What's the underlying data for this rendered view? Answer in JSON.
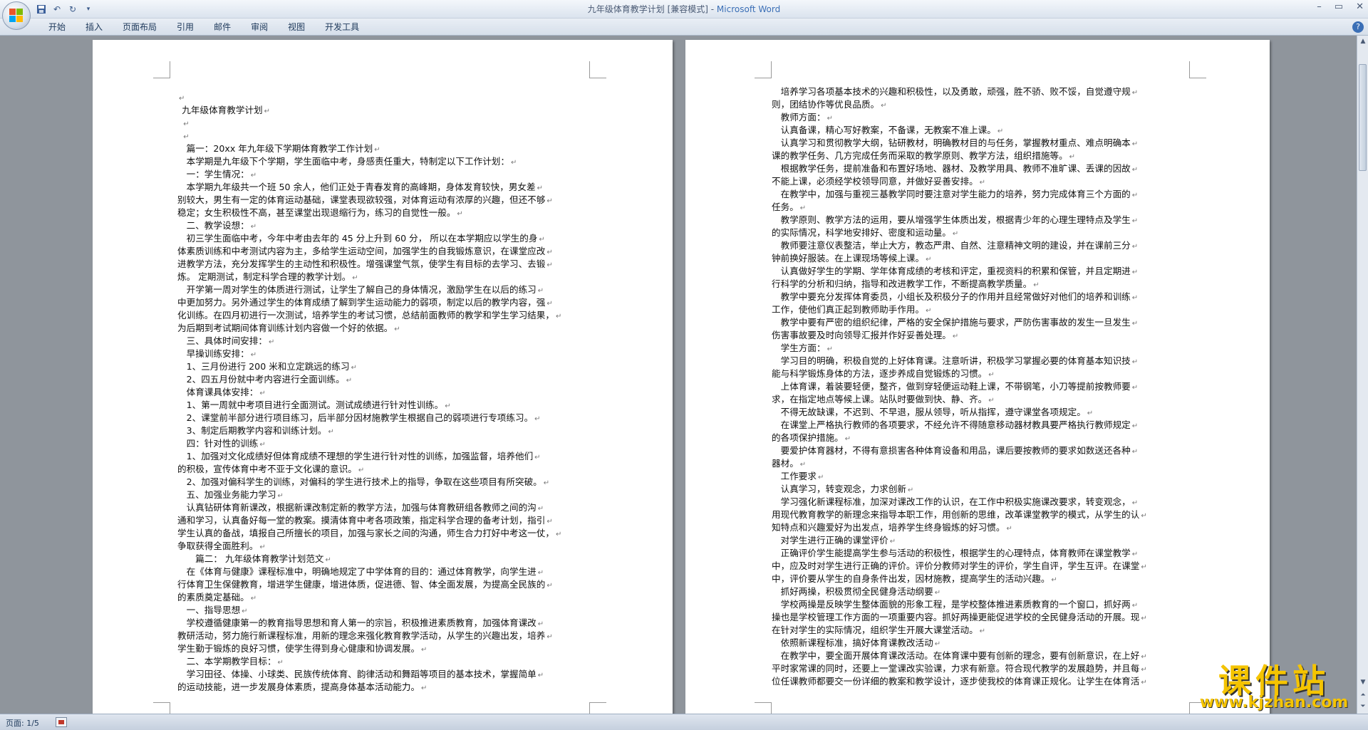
{
  "window": {
    "title": "九年级体育教学计划 [兼容模式] - ",
    "brand": "Microsoft Word"
  },
  "quick_access": {
    "icons": [
      "save-icon",
      "undo-icon",
      "redo-icon",
      "customize-icon"
    ]
  },
  "ribbon": {
    "tabs": [
      "开始",
      "插入",
      "页面布局",
      "引用",
      "邮件",
      "审阅",
      "视图",
      "开发工具"
    ]
  },
  "status": {
    "page": "页面: 1/5"
  },
  "watermark": {
    "title": "课件站",
    "url": "www.kjzhan.com"
  },
  "pages": [
    {
      "lines": [
        {
          "t": "",
          "i": 0
        },
        {
          "t": "九年级体育教学计划",
          "i": 1
        },
        {
          "t": "",
          "i": 1
        },
        {
          "t": "",
          "i": 1
        },
        {
          "t": "篇一：20xx 年九年级下学期体育教学工作计划",
          "i": 2
        },
        {
          "t": "本学期是九年级下个学期，学生面临中考，身感责任重大，特制定以下工作计划：",
          "i": 2
        },
        {
          "t": "一：学生情况：",
          "i": 2
        },
        {
          "t": "本学期九年级共一个班 50 余人，他们正处于青春发育的高峰期，身体发育较快，男女差",
          "i": 2
        },
        {
          "t": "别较大，男生有一定的体育运动基础，课堂表现欲较强，对体育运动有浓厚的兴趣，但还不够",
          "i": 0
        },
        {
          "t": "稳定；女生积极性不高，甚至课堂出现退缩行为，练习的自觉性一般。",
          "i": 0
        },
        {
          "t": "二、教学设想：",
          "i": 2
        },
        {
          "t": "初三学生面临中考，今年中考由去年的 45 分上升到 60 分，  所以在本学期应以学生的身",
          "i": 2
        },
        {
          "t": "体素质训练和中考测试内容为主，多给学生运动空间，加强学生的自我锻炼意识，在课堂应改",
          "i": 0
        },
        {
          "t": "进教学方法，充分发挥学生的主动性和积极性。增强课堂气氛，使学生有目标的去学习、去锻",
          "i": 0
        },
        {
          "t": "炼。          定期测试，制定科学合理的教学计划。",
          "i": 0
        },
        {
          "t": "开学第一周对学生的体质进行测试，让学生了解自己的身体情况，激励学生在以后的练习",
          "i": 2
        },
        {
          "t": "中更加努力。另外通过学生的体育成绩了解到学生运动能力的弱项，制定以后的教学内容，强",
          "i": 0
        },
        {
          "t": "化训练。在四月初进行一次测试，培养学生的考试习惯，总结前面教师的教学和学生学习结果，",
          "i": 0
        },
        {
          "t": "为后期到考试期间体育训练计划内容做一个好的依据。",
          "i": 0
        },
        {
          "t": "三、具体时间安排：",
          "i": 2
        },
        {
          "t": "早操训练安排：",
          "i": 2
        },
        {
          "t": "1、三月份进行 200 米和立定跳远的练习",
          "i": 2
        },
        {
          "t": "2、四五月份就中考内容进行全面训练。",
          "i": 2
        },
        {
          "t": "体育课具体安排：",
          "i": 2
        },
        {
          "t": "1、第一周就中考项目进行全面测试。测试成绩进行针对性训练。",
          "i": 2
        },
        {
          "t": "2、课堂前半部分进行项目练习，后半部分因材施教学生根据自己的弱项进行专项练习。",
          "i": 2
        },
        {
          "t": "3、制定后期教学内容和训练计划。",
          "i": 2
        },
        {
          "t": "四：针对性的训练",
          "i": 2
        },
        {
          "t": "1、加强对文化成绩好但体育成绩不理想的学生进行针对性的训练，加强监督，培养他们",
          "i": 2
        },
        {
          "t": "的积极，宣传体育中考不亚于文化课的意识。",
          "i": 0
        },
        {
          "t": "2、加强对偏科学生的训练，对偏科的学生进行技术上的指导，争取在这些项目有所突破。",
          "i": 2
        },
        {
          "t": "五、加强业务能力学习",
          "i": 2
        },
        {
          "t": "认真钻研体育新课改，根据新课改制定新的教学方法，加强与体育教研组各教师之间的沟",
          "i": 2
        },
        {
          "t": "通和学习，认真备好每一堂的教案。摸清体育中考各项政策，指定科学合理的备考计划，指引",
          "i": 0
        },
        {
          "t": "学生认真的备战，填报自己所擅长的项目，加强与家长之间的沟通，师生合力打好中考这一仗，",
          "i": 0
        },
        {
          "t": "争取获得全面胜利。",
          "i": 0
        },
        {
          "t": "篇二：  九年级体育教学计划范文",
          "i": 4
        },
        {
          "t": "在《体育与健康》课程标准中，明确地规定了中学体育的目的：通过体育教学，向学生进",
          "i": 2
        },
        {
          "t": "行体育卫生保健教育，增进学生健康，增进体质，促进德、智、体全面发展，为提高全民族的",
          "i": 0
        },
        {
          "t": "的素质奠定基础。",
          "i": 0
        },
        {
          "t": "一、指导思想",
          "i": 2
        },
        {
          "t": "学校遵循健康第一的教育指导思想和育人第一的宗旨，积极推进素质教育，加强体育课改",
          "i": 2
        },
        {
          "t": "教研活动，努力施行新课程标准，用新的理念来强化教育教学活动，从学生的兴趣出发，培养",
          "i": 0
        },
        {
          "t": "学生勤于锻炼的良好习惯，使学生得到身心健康和协调发展。",
          "i": 0
        },
        {
          "t": "二、本学期教学目标：",
          "i": 2
        },
        {
          "t": "学习田径、体操、小球类、民族传统体育、韵律活动和舞蹈等项目的基本技术，掌握简单",
          "i": 2
        },
        {
          "t": "的运动技能，进一步发展身体素质，提高身体基本活动能力。",
          "i": 0
        }
      ]
    },
    {
      "lines": [
        {
          "t": "培养学习各项基本技术的兴趣和积极性，以及勇敢，顽强，胜不骄、败不馁，自觉遵守规",
          "i": 2
        },
        {
          "t": "则，团结协作等优良品质。",
          "i": 0
        },
        {
          "t": "教师方面：",
          "i": 2
        },
        {
          "t": "认真备课，精心写好教案，不备课，无教案不准上课。",
          "i": 2
        },
        {
          "t": "认真学习和贯彻教学大纲，钻研教材，明确教材目的与任务，掌握教材重点、难点明确本",
          "i": 2
        },
        {
          "t": "课的教学任务、几方完成任务而采取的教学原则、教学方法，组织措施等。",
          "i": 0
        },
        {
          "t": "根据教学任务，提前准备和布置好场地、器材、及教学用具、教师不准旷课、丢课的因故",
          "i": 2
        },
        {
          "t": "不能上课，必须经学校领导同意，并做好妥善安排。",
          "i": 0
        },
        {
          "t": "在教学中，加强与重视三基教学同时要注意对学生能力的培养，努力完成体育三个方面的",
          "i": 2
        },
        {
          "t": "任务。",
          "i": 0
        },
        {
          "t": "教学原则、教学方法的运用，要从增强学生体质出发，根据青少年的心理生理特点及学生",
          "i": 2
        },
        {
          "t": "的实际情况，科学地安排好、密度和运动量。",
          "i": 0
        },
        {
          "t": "教师要注意仪表整洁，举止大方，教态严肃、自然、注意精神文明的建设，并在课前三分",
          "i": 2
        },
        {
          "t": "钟前换好服装。在上课现场等候上课。",
          "i": 0
        },
        {
          "t": "认真做好学生的学期、学年体育成绩的考核和评定，重视资料的积累和保管，并且定期进",
          "i": 2
        },
        {
          "t": "行科学的分析和归纳，指导和改进教学工作，不断提高教学质量。",
          "i": 0
        },
        {
          "t": "教学中要充分发挥体育委员，小组长及积极分子的作用并且经常做好对他们的培养和训练",
          "i": 2
        },
        {
          "t": "工作，使他们真正起到教师助手作用。",
          "i": 0
        },
        {
          "t": "教学中要有严密的组织纪律，严格的安全保护措施与要求，严防伤害事故的发生一旦发生",
          "i": 2
        },
        {
          "t": "伤害事故要及时向领导汇报并作好妥善处理。",
          "i": 0
        },
        {
          "t": "学生方面：",
          "i": 2
        },
        {
          "t": "学习目的明确，积极自觉的上好体育课。注意听讲，积极学习掌握必要的体育基本知识技",
          "i": 2
        },
        {
          "t": "能与科学锻炼身体的方法，逐步养成自觉锻炼的习惯。",
          "i": 0
        },
        {
          "t": "上体育课，着装要轻便，整齐，做到穿轻便运动鞋上课，不带钢笔，小刀等提前按教师要",
          "i": 2
        },
        {
          "t": "求，在指定地点等候上课。站队时要做到快、静、齐。",
          "i": 0
        },
        {
          "t": "不得无故缺课，不迟到、不早退，服从领导，听从指挥，遵守课堂各项规定。",
          "i": 2
        },
        {
          "t": "在课堂上严格执行教师的各项要求，不经允许不得随意移动器材教具要严格执行教师规定",
          "i": 2
        },
        {
          "t": "的各项保护措施。",
          "i": 0
        },
        {
          "t": "要爱护体育器材，不得有意损害各种体育设备和用品，课后要按教师的要求如数送还各种",
          "i": 2
        },
        {
          "t": "器材。",
          "i": 0
        },
        {
          "t": "工作要求",
          "i": 2
        },
        {
          "t": "认真学习，转变观念，力求创新",
          "i": 2
        },
        {
          "t": "学习强化新课程标准，加深对课改工作的认识，在工作中积极实施课改要求，转变观念，",
          "i": 2
        },
        {
          "t": "用现代教育教学的新理念来指导本职工作，用创新的思维，改革课堂教学的模式，从学生的认",
          "i": 0
        },
        {
          "t": "知特点和兴趣爱好为出发点，培养学生终身锻炼的好习惯。",
          "i": 0
        },
        {
          "t": "对学生进行正确的课堂评价",
          "i": 2
        },
        {
          "t": "正确评价学生能提高学生参与活动的积极性，根据学生的心理特点，体育教师在课堂教学",
          "i": 2
        },
        {
          "t": "中，应及时对学生进行正确的评价。评价分教师对学生的评价，学生自评，学生互评。在课堂",
          "i": 0
        },
        {
          "t": "中，评价要从学生的自身条件出发，因材施教，提高学生的活动兴趣。",
          "i": 0
        },
        {
          "t": "抓好两操，积极贯彻全民健身活动纲要",
          "i": 2
        },
        {
          "t": "学校两操是反映学生整体面貌的形象工程，是学校整体推进素质教育的一个窗口，抓好两",
          "i": 2
        },
        {
          "t": "操也是学校管理工作方面的一项重要内容。抓好两操更能促进学校的全民健身活动的开展。现",
          "i": 0
        },
        {
          "t": "在针对学生的实际情况，组织学生开展大课堂活动。",
          "i": 0
        },
        {
          "t": "依照新课程标准，搞好体育课教改活动",
          "i": 2
        },
        {
          "t": "在教学中，要全面开展体育课改活动。在体育课中要有创新的理念，要有创新意识，在上好",
          "i": 2
        },
        {
          "t": "平时家常课的同时，还要上一堂课改实验课，力求有新意。符合现代教学的发展趋势，并且每",
          "i": 0
        },
        {
          "t": "位任课教师都要交一份详细的教案和教学设计，逐步使我校的体育课正规化。让学生在体育活",
          "i": 0
        }
      ]
    }
  ]
}
